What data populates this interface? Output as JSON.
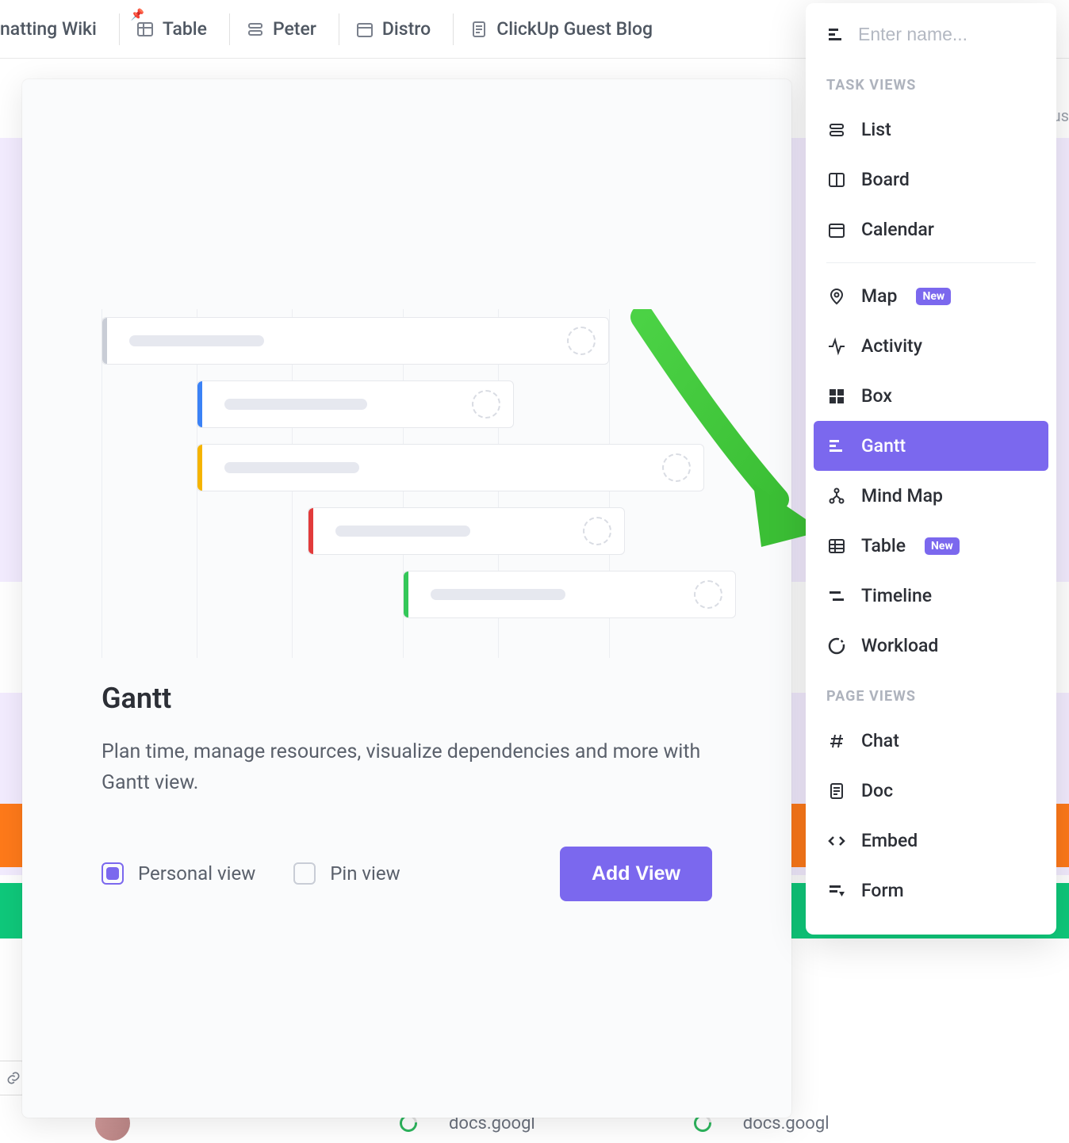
{
  "top_tabs": {
    "wiki": "natting Wiki",
    "table": "Table",
    "peter": "Peter",
    "distro": "Distro",
    "guest_blog": "ClickUp Guest Blog"
  },
  "search": {
    "placeholder": "Enter name..."
  },
  "sections": {
    "task_views": "TASK VIEWS",
    "page_views": "PAGE VIEWS"
  },
  "views": {
    "list": "List",
    "board": "Board",
    "calendar": "Calendar",
    "map": "Map",
    "activity": "Activity",
    "box": "Box",
    "gantt": "Gantt",
    "mind_map": "Mind Map",
    "table": "Table",
    "timeline": "Timeline",
    "workload": "Workload",
    "chat": "Chat",
    "doc": "Doc",
    "embed": "Embed",
    "form": "Form"
  },
  "badges": {
    "new": "New"
  },
  "preview": {
    "title": "Gantt",
    "description": "Plan time, manage resources, visualize dependencies and more with Gantt view.",
    "personal_view": "Personal view",
    "pin_view": "Pin view",
    "add_view": "Add View"
  },
  "bottom": {
    "docs1": "docs.googl",
    "docs2": "docs.googl"
  },
  "bg_clip": {
    "us": "us"
  }
}
